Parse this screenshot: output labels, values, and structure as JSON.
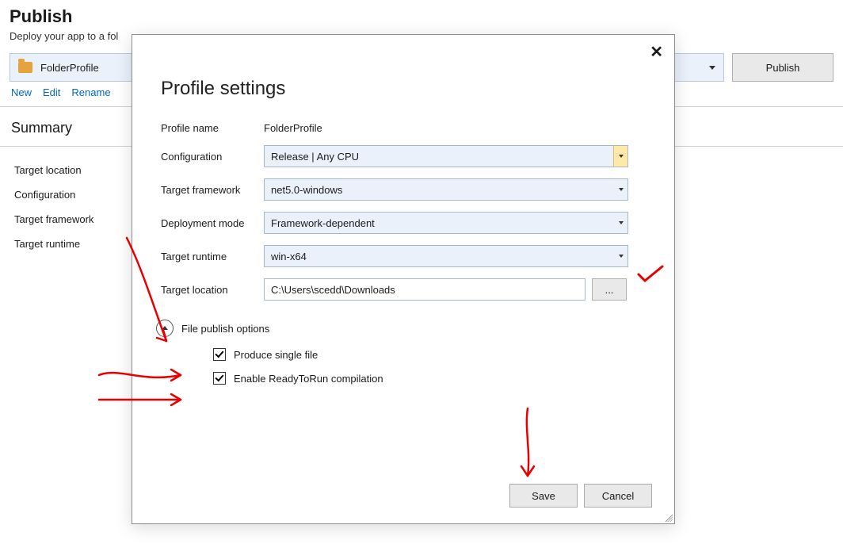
{
  "page": {
    "title": "Publish",
    "subtitle_before": "Deploy your app to a fol",
    "publish_button": "Publish",
    "profile_dropdown_text": "FolderProfile"
  },
  "actions": {
    "new": "New",
    "edit": "Edit",
    "rename": "Rename"
  },
  "summary": {
    "title": "Summary",
    "items": [
      "Target location",
      "Configuration",
      "Target framework",
      "Target runtime"
    ]
  },
  "dialog": {
    "title": "Profile settings",
    "labels": {
      "profile_name": "Profile name",
      "configuration": "Configuration",
      "target_framework": "Target framework",
      "deployment_mode": "Deployment mode",
      "target_runtime": "Target runtime",
      "target_location": "Target location",
      "file_publish_options": "File publish options",
      "produce_single_file": "Produce single file",
      "enable_r2r": "Enable ReadyToRun compilation"
    },
    "values": {
      "profile_name": "FolderProfile",
      "configuration": "Release | Any CPU",
      "target_framework": "net5.0-windows",
      "deployment_mode": "Framework-dependent",
      "target_runtime": "win-x64",
      "target_location": "C:\\Users\\scedd\\Downloads"
    },
    "buttons": {
      "browse": "...",
      "save": "Save",
      "cancel": "Cancel"
    },
    "checked": {
      "produce_single_file": true,
      "enable_r2r": true
    }
  }
}
